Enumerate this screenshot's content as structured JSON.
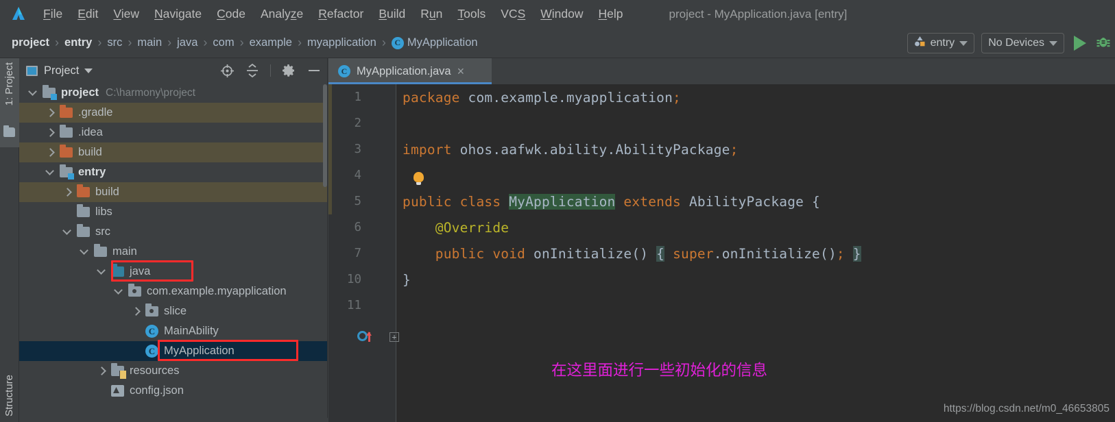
{
  "window": {
    "title": "project - MyApplication.java [entry]",
    "logo_icon": "idea-logo-icon"
  },
  "menubar": {
    "items": [
      {
        "label": "File",
        "mnemonic": "F"
      },
      {
        "label": "Edit",
        "mnemonic": "E"
      },
      {
        "label": "View",
        "mnemonic": "V"
      },
      {
        "label": "Navigate",
        "mnemonic": "N"
      },
      {
        "label": "Code",
        "mnemonic": "C"
      },
      {
        "label": "Analyze",
        "mnemonic": "z"
      },
      {
        "label": "Refactor",
        "mnemonic": "R"
      },
      {
        "label": "Build",
        "mnemonic": "B"
      },
      {
        "label": "Run",
        "mnemonic": "u"
      },
      {
        "label": "Tools",
        "mnemonic": "T"
      },
      {
        "label": "VCS",
        "mnemonic": "S"
      },
      {
        "label": "Window",
        "mnemonic": "W"
      },
      {
        "label": "Help",
        "mnemonic": "H"
      }
    ]
  },
  "breadcrumb": {
    "separator": "›",
    "items": [
      {
        "label": "project",
        "bold": true
      },
      {
        "label": "entry",
        "bold": true
      },
      {
        "label": "src",
        "bold": false
      },
      {
        "label": "main",
        "bold": false
      },
      {
        "label": "java",
        "bold": false
      },
      {
        "label": "com",
        "bold": false
      },
      {
        "label": "example",
        "bold": false
      },
      {
        "label": "myapplication",
        "bold": false
      }
    ],
    "final_class": {
      "label": "MyApplication",
      "icon": "class-icon",
      "icon_letter": "C"
    }
  },
  "toolbar": {
    "run_config": {
      "label": "entry",
      "icon": "module-config-icon"
    },
    "device": {
      "label": "No Devices"
    },
    "run_button": {
      "name": "run-button",
      "color": "#59a869"
    },
    "debug_button": {
      "name": "debug-button",
      "glyph": "🐞",
      "color": "#59a869"
    }
  },
  "left_stripe": {
    "top_tab": "1: Project",
    "bottom_tab": "Structure",
    "favorites_icon": "folder-icon"
  },
  "project_panel": {
    "title": "Project",
    "window_icon": "project-window-icon",
    "tools": [
      {
        "name": "locate-icon"
      },
      {
        "name": "collapse-all-icon"
      },
      {
        "name": "settings-gear-icon"
      },
      {
        "name": "hide-panel-icon"
      }
    ],
    "tree": [
      {
        "indent": 0,
        "arrow": "down",
        "icon": "module-folder-icon",
        "label": "project",
        "bold": true,
        "path": "C:\\harmony\\project",
        "state": "normal"
      },
      {
        "indent": 1,
        "arrow": "right",
        "icon": "folder-orange-icon",
        "label": ".gradle",
        "bold": false,
        "path": "",
        "state": "excluded"
      },
      {
        "indent": 1,
        "arrow": "right",
        "icon": "folder-grey-icon",
        "label": ".idea",
        "bold": false,
        "path": "",
        "state": "normal"
      },
      {
        "indent": 1,
        "arrow": "right",
        "icon": "folder-orange-icon",
        "label": "build",
        "bold": false,
        "path": "",
        "state": "excluded"
      },
      {
        "indent": 1,
        "arrow": "down",
        "icon": "module-folder-icon",
        "label": "entry",
        "bold": true,
        "path": "",
        "state": "normal"
      },
      {
        "indent": 2,
        "arrow": "right",
        "icon": "folder-orange-icon",
        "label": "build",
        "bold": false,
        "path": "",
        "state": "excluded"
      },
      {
        "indent": 2,
        "arrow": "none",
        "icon": "folder-grey-icon",
        "label": "libs",
        "bold": false,
        "path": "",
        "state": "normal"
      },
      {
        "indent": 2,
        "arrow": "down",
        "icon": "folder-grey-icon",
        "label": "src",
        "bold": false,
        "path": "",
        "state": "normal"
      },
      {
        "indent": 3,
        "arrow": "down",
        "icon": "folder-grey-icon",
        "label": "main",
        "bold": false,
        "path": "",
        "state": "normal"
      },
      {
        "indent": 4,
        "arrow": "down",
        "icon": "folder-source-icon",
        "label": "java",
        "bold": false,
        "path": "",
        "state": "normal"
      },
      {
        "indent": 5,
        "arrow": "down",
        "icon": "package-icon",
        "label": "com.example.myapplication",
        "bold": false,
        "path": "",
        "state": "normal"
      },
      {
        "indent": 6,
        "arrow": "right",
        "icon": "package-icon",
        "label": "slice",
        "bold": false,
        "path": "",
        "state": "normal"
      },
      {
        "indent": 6,
        "arrow": "none",
        "icon": "class-icon",
        "label": "MainAbility",
        "bold": false,
        "path": "",
        "state": "normal"
      },
      {
        "indent": 6,
        "arrow": "none",
        "icon": "class-icon",
        "label": "MyApplication",
        "bold": false,
        "path": "",
        "state": "selected"
      },
      {
        "indent": 4,
        "arrow": "right",
        "icon": "resources-folder-icon",
        "label": "resources",
        "bold": false,
        "path": "",
        "state": "normal"
      },
      {
        "indent": 4,
        "arrow": "none",
        "icon": "config-json-icon",
        "label": "config.json",
        "bold": false,
        "path": "",
        "state": "normal"
      }
    ],
    "annotations": [
      {
        "name": "red-box-java",
        "target": "java"
      },
      {
        "name": "red-box-myapplication",
        "target": "MyApplication"
      }
    ]
  },
  "editor": {
    "tab": {
      "label": "MyApplication.java",
      "icon": "class-icon",
      "icon_letter": "C",
      "close_glyph": "×"
    },
    "gutter_icons": [
      {
        "line": 4,
        "name": "intention-bulb-icon"
      },
      {
        "line": 7,
        "name": "override-method-marker-icon"
      },
      {
        "line": 7,
        "name": "code-fold-expand-icon",
        "glyph": "+"
      }
    ],
    "lines": [
      {
        "num": "1",
        "segments": [
          {
            "t": "package",
            "c": "kw"
          },
          {
            "t": " com.example.myapplication",
            "c": "punc"
          },
          {
            "t": ";",
            "c": "semi"
          }
        ]
      },
      {
        "num": "2",
        "segments": []
      },
      {
        "num": "3",
        "segments": [
          {
            "t": "import",
            "c": "kw"
          },
          {
            "t": " ohos.aafwk.ability.AbilityPackage",
            "c": "punc"
          },
          {
            "t": ";",
            "c": "semi"
          }
        ]
      },
      {
        "num": "4",
        "segments": []
      },
      {
        "num": "5",
        "segments": [
          {
            "t": "public class ",
            "c": "kw"
          },
          {
            "t": "MyApplication",
            "c": "hl-ident"
          },
          {
            "t": " ",
            "c": "punc"
          },
          {
            "t": "extends",
            "c": "kw"
          },
          {
            "t": " AbilityPackage {",
            "c": "punc"
          }
        ]
      },
      {
        "num": "6",
        "segments": [
          {
            "t": "    @Override",
            "c": "anno"
          }
        ]
      },
      {
        "num": "7",
        "segments": [
          {
            "t": "    public void ",
            "c": "kw"
          },
          {
            "t": "onInitialize",
            "c": "method"
          },
          {
            "t": "()",
            "c": "punc"
          },
          {
            "t": " ",
            "c": "punc"
          },
          {
            "t": "{",
            "c": "hl-brace"
          },
          {
            "t": " ",
            "c": "punc"
          },
          {
            "t": "super",
            "c": "kw"
          },
          {
            "t": ".onInitialize()",
            "c": "punc"
          },
          {
            "t": ";",
            "c": "semi"
          },
          {
            "t": " ",
            "c": "punc"
          },
          {
            "t": "}",
            "c": "hl-brace"
          }
        ]
      },
      {
        "num": "10",
        "segments": [
          {
            "t": "}",
            "c": "punc"
          }
        ]
      },
      {
        "num": "11",
        "segments": []
      }
    ],
    "annotation_note": "在这里面进行一些初始化的信息",
    "watermark": "https://blog.csdn.net/m0_46653805"
  },
  "colors": {
    "accent_blue": "#3592c4",
    "keyword_orange": "#cc7832",
    "annotation_yellow": "#bbb529",
    "highlight_green": "#32593d",
    "annotation_pink": "#e020d8",
    "red_box": "#fc2b2b",
    "selection_blue": "#0d293e",
    "excluded_olive": "#55503c",
    "editor_bg": "#2b2b2b",
    "panel_bg": "#3c3f41"
  }
}
